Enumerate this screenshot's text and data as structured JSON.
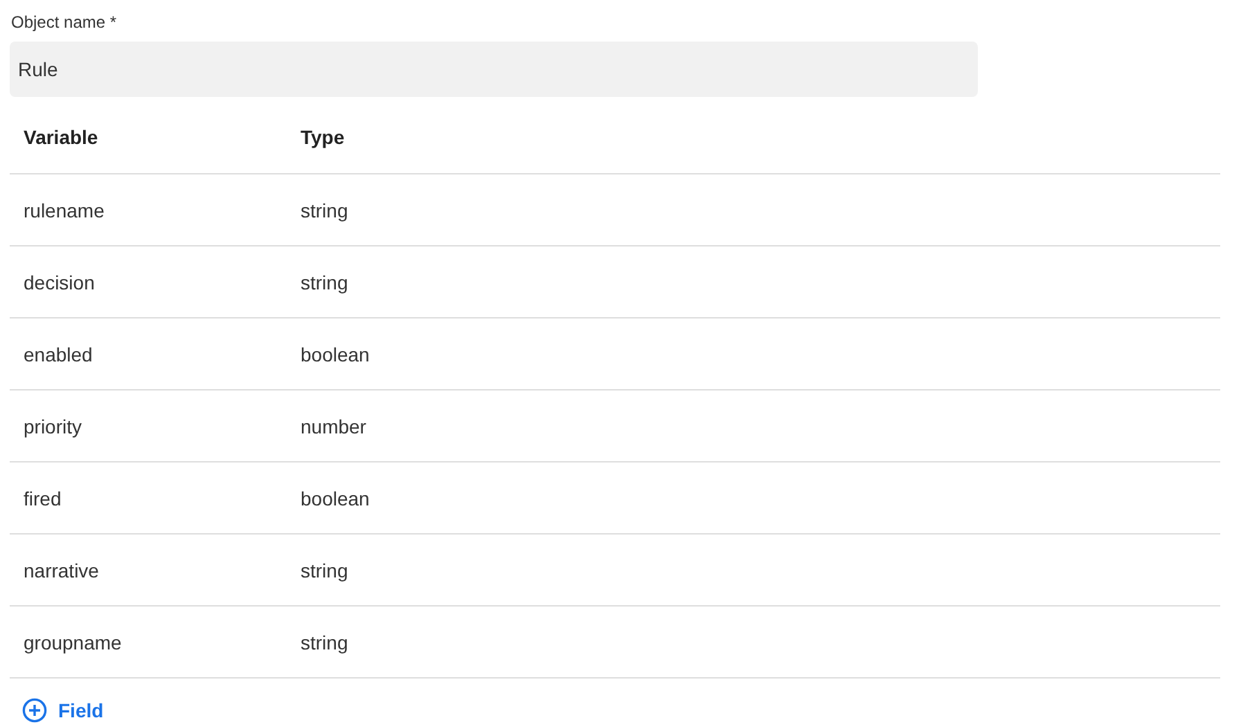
{
  "object_name": {
    "label": "Object name *",
    "value": "Rule"
  },
  "table": {
    "columns": [
      "Variable",
      "Type"
    ],
    "rows": [
      [
        "rulename",
        "string"
      ],
      [
        "decision",
        "string"
      ],
      [
        "enabled",
        "boolean"
      ],
      [
        "priority",
        "number"
      ],
      [
        "fired",
        "boolean"
      ],
      [
        "narrative",
        "string"
      ],
      [
        "groupname",
        "string"
      ]
    ]
  },
  "add_button": {
    "label": "Field"
  }
}
